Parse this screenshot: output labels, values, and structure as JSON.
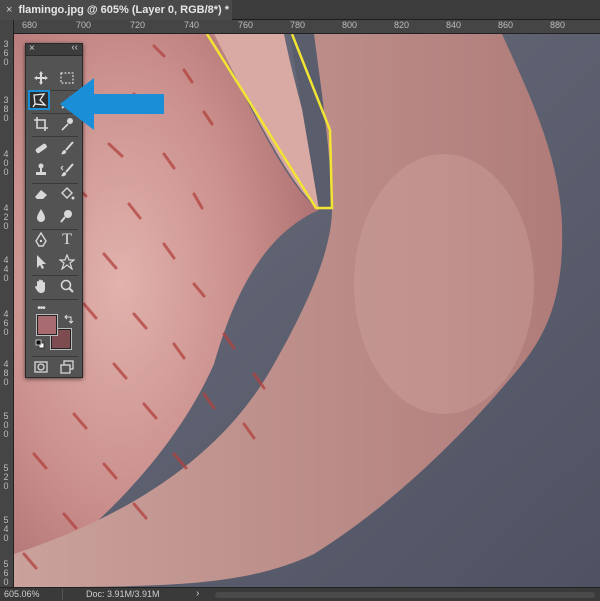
{
  "document": {
    "tab_close": "×",
    "title": "flamingo.jpg @ 605% (Layer 0, RGB/8*) *"
  },
  "rulers": {
    "top_labels": [
      "680",
      "700",
      "720",
      "740",
      "760",
      "780",
      "800",
      "820",
      "840",
      "860",
      "880"
    ],
    "left_labels": [
      "3 6 0",
      "3 8 0",
      "4 0 0",
      "4 2 0",
      "4 4 0",
      "4 6 0",
      "4 8 0",
      "5 0 0",
      "5 2 0",
      "5 4 0",
      "5 6 0"
    ]
  },
  "tools_panel": {
    "close_glyph": "×",
    "collapse_glyph": "‹‹",
    "tools": [
      {
        "name": "move-tool",
        "icon": "move-icon"
      },
      {
        "name": "marquee-tool",
        "icon": "rect-marquee-icon"
      },
      {
        "name": "polygonal-lasso-tool",
        "icon": "polygonal-lasso-icon",
        "active": true
      },
      {
        "name": "magic-wand-tool",
        "icon": "magic-wand-icon"
      },
      {
        "name": "crop-tool",
        "icon": "crop-icon"
      },
      {
        "name": "eyedropper-tool",
        "icon": "eyedropper-icon"
      },
      {
        "name": "healing-brush-tool",
        "icon": "bandage-icon"
      },
      {
        "name": "brush-tool",
        "icon": "brush-icon"
      },
      {
        "name": "clone-stamp-tool",
        "icon": "stamp-icon"
      },
      {
        "name": "history-brush-tool",
        "icon": "history-brush-icon"
      },
      {
        "name": "eraser-tool",
        "icon": "eraser-icon"
      },
      {
        "name": "paint-bucket-tool",
        "icon": "paint-bucket-icon"
      },
      {
        "name": "blur-tool",
        "icon": "blur-drop-icon"
      },
      {
        "name": "dodge-tool",
        "icon": "dodge-icon"
      },
      {
        "name": "pen-tool",
        "icon": "pen-icon"
      },
      {
        "name": "type-tool",
        "icon": "type-icon",
        "glyph": "T"
      },
      {
        "name": "path-selection-tool",
        "icon": "path-arrow-icon"
      },
      {
        "name": "custom-shape-tool",
        "icon": "custom-shape-icon"
      },
      {
        "name": "hand-tool",
        "icon": "hand-icon"
      },
      {
        "name": "zoom-tool",
        "icon": "zoom-icon"
      },
      {
        "name": "edit-toolbar",
        "icon": "more-icon",
        "glyph": "•••"
      }
    ],
    "foreground_color": "#a86c70",
    "background_color": "#7c4c50"
  },
  "status": {
    "zoom": "605.06%",
    "doc_size": "Doc: 3.91M/3.91M",
    "chevron": "›"
  },
  "colors": {
    "selection_line": "#f2e432",
    "highlight_arrow": "#1a8fd8",
    "canvas_background": "#5c5f6e"
  }
}
